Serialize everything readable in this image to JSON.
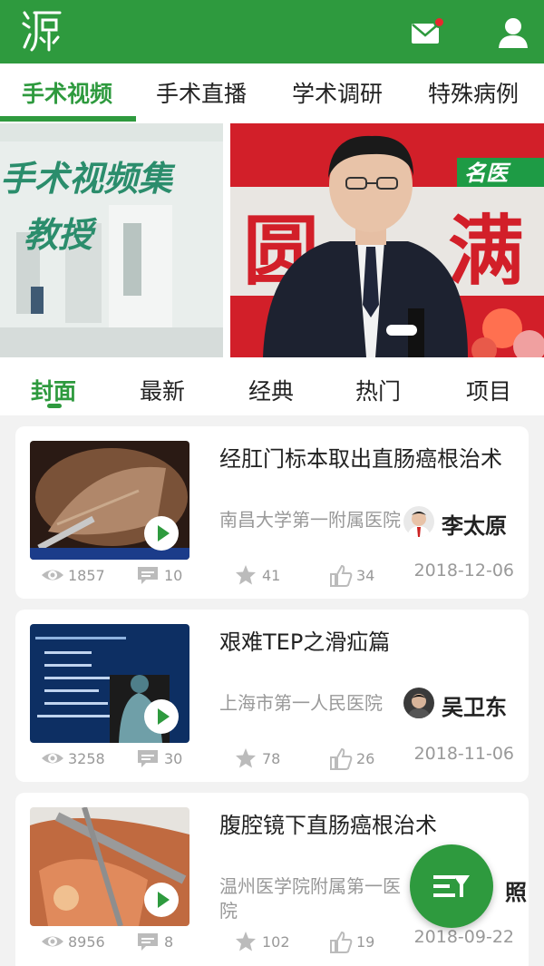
{
  "app": {
    "logo_text": "源"
  },
  "header": {
    "mail_icon": "mail-icon",
    "user_icon": "user-icon",
    "has_unread": true
  },
  "main_tabs": [
    {
      "label": "手术视频",
      "active": true
    },
    {
      "label": "手术直播",
      "active": false
    },
    {
      "label": "学术调研",
      "active": false
    },
    {
      "label": "特殊病例",
      "active": false
    }
  ],
  "banner": {
    "left_line1": "手术视频集",
    "left_line2": "教授",
    "right_text": "圆满",
    "right_badge": "名医",
    "slide_count_indicator": "current"
  },
  "sub_tabs": [
    {
      "label": "封面",
      "active": true
    },
    {
      "label": "最新",
      "active": false
    },
    {
      "label": "经典",
      "active": false
    },
    {
      "label": "热门",
      "active": false
    },
    {
      "label": "项目",
      "active": false
    }
  ],
  "videos": [
    {
      "title": "经肛门标本取出直肠癌根治术",
      "hospital": "南昌大学第一附属医院",
      "doctor": "李太原",
      "views": "1857",
      "comments": "10",
      "favorites": "41",
      "likes": "34",
      "date": "2018-12-06"
    },
    {
      "title": "艰难TEP之滑疝篇",
      "hospital": "上海市第一人民医院",
      "doctor": "吴卫东",
      "views": "3258",
      "comments": "30",
      "favorites": "78",
      "likes": "26",
      "date": "2018-11-06"
    },
    {
      "title": "腹腔镜下直肠癌根治术",
      "hospital": "温州医学院附属第一医院",
      "doctor": "照",
      "views": "8956",
      "comments": "8",
      "favorites": "102",
      "likes": "19",
      "date": "2018-09-22"
    }
  ],
  "fab": {
    "icon": "filter-icon"
  },
  "colors": {
    "brand": "#2e9a3e",
    "badge": "#e8282e",
    "muted": "#999999"
  }
}
